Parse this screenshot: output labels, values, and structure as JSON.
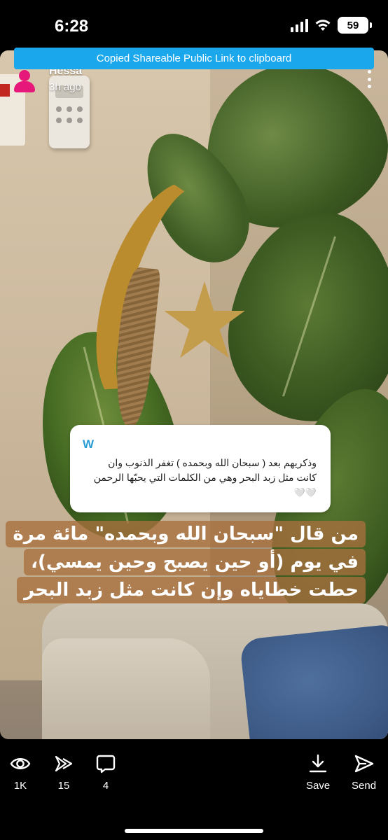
{
  "status_bar": {
    "time": "6:28",
    "battery": "59",
    "icons": [
      "cellular-signal-icon",
      "wifi-icon",
      "battery-icon"
    ]
  },
  "toast": {
    "text": "Copied Shareable Public Link to clipboard",
    "color": "#1aa7ec"
  },
  "story": {
    "user_name": "Hessa",
    "time_ago": "3h ago",
    "avatar_color": "#e6197a",
    "quote": {
      "initial": "W",
      "text": "وذكريهم بعد ( سبحان الله وبحمده ) تغفر الذنوب وان كانت مثل زبد البحر وهي من الكلمات التي يحبّها الرحمن",
      "hearts": "🤍🤍"
    },
    "caption": [
      "من قال \"سبحان الله وبحمده\" مائة مرة",
      "في يوم (أو حين يصبح وحين يمسي)،",
      "حطت خطاياه وإن كانت مثل زبد البحر"
    ]
  },
  "bottom_bar": {
    "views": "1K",
    "replays": "15",
    "replies": "4",
    "save_label": "Save",
    "send_label": "Send"
  }
}
